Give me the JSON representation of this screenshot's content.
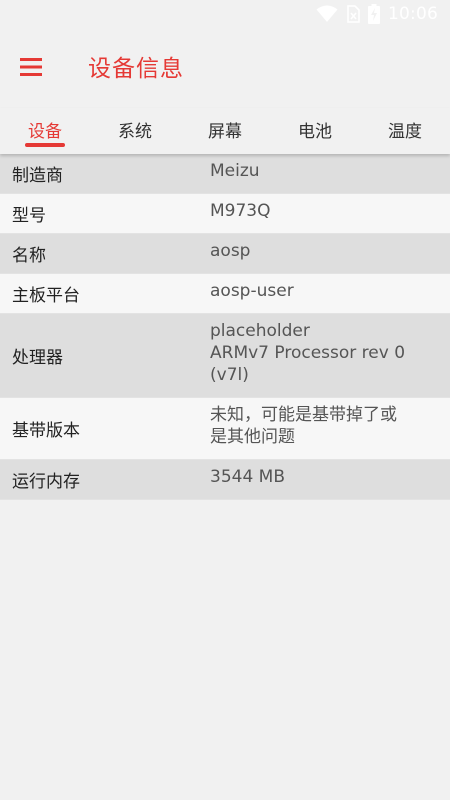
{
  "status_bar": {
    "time": "10:06",
    "icons": [
      "wifi-icon",
      "no-sim-icon",
      "battery-charging-icon"
    ]
  },
  "toolbar": {
    "title": "设备信息",
    "menu_icon": "hamburger-menu-icon"
  },
  "colors": {
    "accent": "#e53935",
    "background": "#f1f1f1",
    "row_shaded": "#dedede",
    "row_light": "#f7f7f7"
  },
  "tabs": [
    {
      "label": "设备",
      "active": true
    },
    {
      "label": "系统",
      "active": false
    },
    {
      "label": "屏幕",
      "active": false
    },
    {
      "label": "电池",
      "active": false
    },
    {
      "label": "温度",
      "active": false
    }
  ],
  "info": [
    {
      "label": "制造商",
      "value": "Meizu"
    },
    {
      "label": "型号",
      "value": "M973Q"
    },
    {
      "label": "名称",
      "value": "aosp"
    },
    {
      "label": "主板平台",
      "value": "aosp-user"
    },
    {
      "label": "处理器",
      "value": "placeholder\nARMv7 Processor rev 0\n(v7l)"
    },
    {
      "label": "基带版本",
      "value": "未知，可能是基带掉了或\n是其他问题"
    },
    {
      "label": "运行内存",
      "value": "3544 MB"
    }
  ]
}
